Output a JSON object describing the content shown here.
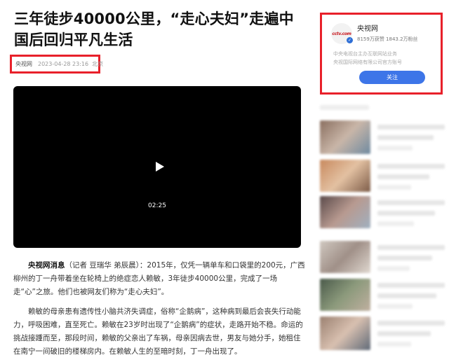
{
  "article": {
    "title": "三年徒步40000公里，“走心夫妇”走遍中国后回归平凡生活",
    "source": "央视网",
    "time": "2023-04-28 23:16",
    "location": "北京",
    "video_duration": "02:25",
    "para1_lead": "央视网消息",
    "para1_text": "（记者 豆瑞华 弟辰晨）：2015年，仅凭一辆单车和口袋里的200元，广西柳州的丁一舟带着坐在轮椅上的绝症恋人赖敏，3年徒步40000公里，完成了一场走“心”之旅。他们也被网友们称为“走心夫妇”。",
    "para2_text": "赖敏的母亲患有遗传性小脑共济失调症，俗称“企鹅病”，这种病到最后会丧失行动能力，呼吸困难，直至死亡。赖敏在23岁时出现了“企鹅病”的症状，走路开始不稳。命运的挑战接踵而至，那段时间，赖敏的父亲出了车祸，母亲因病去世，男友与她分手，她租住在南宁一间破旧的楼梯房内。在赖敏人生的至暗时刻，丁一舟出现了。"
  },
  "sidebar": {
    "account_name": "央视网",
    "logo_text": "cctv.com",
    "stats": "8159万获赞 1843.2万粉丝",
    "desc_line1": "中央电视台主办互联网站业务",
    "desc_line2": "央视国际网络有限公司官方账号",
    "follow_label": "关注"
  },
  "colors": {
    "highlight": "#e8202a",
    "follow_button": "#3d75e8"
  }
}
